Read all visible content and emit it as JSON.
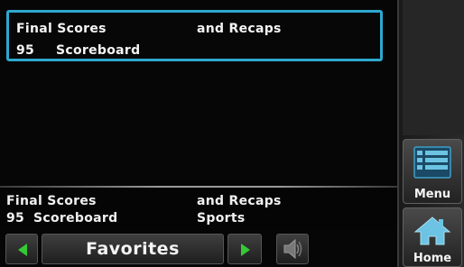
{
  "channel_list": {
    "selected_item": {
      "artist": "Final Scores",
      "title": "and Recaps",
      "number": "95",
      "name": "Scoreboard"
    }
  },
  "now_playing": {
    "artist": "Final Scores",
    "title": "and Recaps",
    "number": "95",
    "channel": "Scoreboard",
    "category": "Sports"
  },
  "controls": {
    "category_label": "Favorites"
  },
  "softkeys": {
    "menu_label": "Menu",
    "home_label": "Home"
  },
  "icons": {
    "prev": "left-arrow-icon",
    "next": "right-arrow-icon",
    "mute": "speaker-icon",
    "menu": "list-menu-icon",
    "home": "house-icon"
  },
  "colors": {
    "selection_border": "#2ea8cf",
    "arrow": "#35c935",
    "menu_icon": "#3d9fc7",
    "home_icon": "#6cc3e4"
  }
}
